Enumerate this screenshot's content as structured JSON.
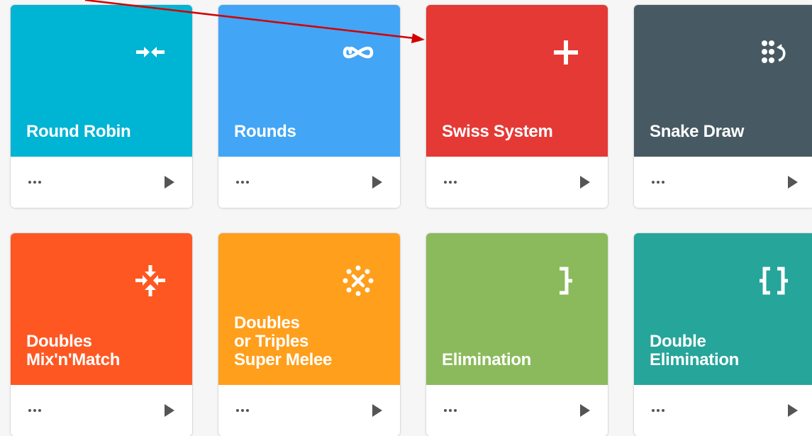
{
  "cards": [
    {
      "title": "Round Robin",
      "color": "#00b4d3",
      "icon": "arrows-converge-icon"
    },
    {
      "title": "Rounds",
      "color": "#42a5f5",
      "icon": "infinity-icon"
    },
    {
      "title": "Swiss System",
      "color": "#e53935",
      "icon": "plus-icon"
    },
    {
      "title": "Snake Draw",
      "color": "#475a63",
      "icon": "dots-rotate-icon"
    },
    {
      "title": "Doubles\nMix'n'Match",
      "color": "#ff5722",
      "icon": "arrows-merge-icon"
    },
    {
      "title": "Doubles\nor Triples\nSuper Melee",
      "color": "#ff9f1c",
      "icon": "circle-x-icon"
    },
    {
      "title": "Elimination",
      "color": "#8bba5c",
      "icon": "bracket-icon"
    },
    {
      "title": "Double\nElimination",
      "color": "#26a59a",
      "icon": "double-bracket-icon"
    }
  ],
  "more_label": "…",
  "annotation": {
    "arrow_color": "#d40000"
  }
}
